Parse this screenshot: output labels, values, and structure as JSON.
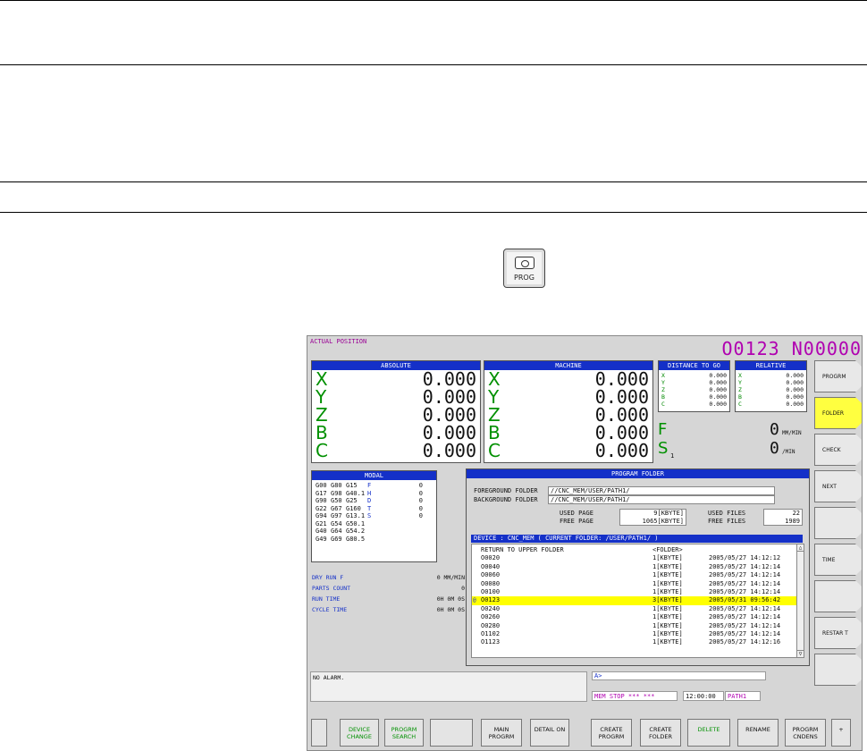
{
  "key": {
    "label": "PROG"
  },
  "screen": {
    "title": "ACTUAL POSITION",
    "program": "O0123 N00000",
    "absolute": {
      "header": "ABSOLUTE",
      "axes": [
        {
          "axis": "X",
          "value": "0.000"
        },
        {
          "axis": "Y",
          "value": "0.000"
        },
        {
          "axis": "Z",
          "value": "0.000"
        },
        {
          "axis": "B",
          "value": "0.000"
        },
        {
          "axis": "C",
          "value": "0.000"
        }
      ]
    },
    "machine": {
      "header": "MACHINE",
      "axes": [
        {
          "axis": "X",
          "value": "0.000"
        },
        {
          "axis": "Y",
          "value": "0.000"
        },
        {
          "axis": "Z",
          "value": "0.000"
        },
        {
          "axis": "B",
          "value": "0.000"
        },
        {
          "axis": "C",
          "value": "0.000"
        }
      ]
    },
    "distance": {
      "header": "DISTANCE TO GO",
      "axes": [
        {
          "axis": "X",
          "value": "0.000"
        },
        {
          "axis": "Y",
          "value": "0.000"
        },
        {
          "axis": "Z",
          "value": "0.000"
        },
        {
          "axis": "B",
          "value": "0.000"
        },
        {
          "axis": "C",
          "value": "0.000"
        }
      ]
    },
    "relative": {
      "header": "RELATIVE",
      "axes": [
        {
          "axis": "X",
          "value": "0.000"
        },
        {
          "axis": "Y",
          "value": "0.000"
        },
        {
          "axis": "Z",
          "value": "0.000"
        },
        {
          "axis": "B",
          "value": "0.000"
        },
        {
          "axis": "C",
          "value": "0.000"
        }
      ]
    },
    "feed": {
      "label": "F",
      "value": "0",
      "unit": "MM/MIN"
    },
    "spindle": {
      "label": "S",
      "sub": "1",
      "value": "0",
      "unit": "/MIN"
    },
    "modal": {
      "header": "MODAL",
      "rows": [
        [
          "G00",
          "G80",
          "G15",
          "F",
          "0"
        ],
        [
          "G17",
          "G98",
          "G40.1",
          "H",
          "0"
        ],
        [
          "G90",
          "G50",
          "G25",
          "D",
          "0"
        ],
        [
          "G22",
          "G67",
          "G160",
          "T",
          "0"
        ],
        [
          "G94",
          "G97",
          "G13.1",
          "S",
          "0"
        ],
        [
          "G21",
          "G54",
          "G50.1",
          "",
          ""
        ],
        [
          "G40",
          "G64",
          "G54.2",
          "",
          ""
        ],
        [
          "G49",
          "G69",
          "G80.5",
          "",
          ""
        ]
      ]
    },
    "info": [
      {
        "label": "DRY RUN F",
        "value": "0 MM/MIN"
      },
      {
        "label": "PARTS COUNT",
        "value": "0"
      },
      {
        "label": "RUN TIME",
        "value": "0H 0M 0S"
      },
      {
        "label": "CYCLE TIME",
        "value": "0H 0M 0S"
      }
    ],
    "folder": {
      "header": "PROGRAM FOLDER",
      "fg_label": "FOREGROUND FOLDER",
      "fg_value": "//CNC_MEM/USER/PATH1/",
      "bg_label": "BACKGROUND FOLDER",
      "bg_value": "//CNC_MEM/USER/PATH1/",
      "used_page_label": "USED PAGE",
      "used_page": "9[KBYTE]",
      "free_page_label": "FREE PAGE",
      "free_page": "1065[KBYTE]",
      "used_files_label": "USED FILES",
      "used_files": "22",
      "free_files_label": "FREE FILES",
      "free_files": "1989",
      "device_bar": "DEVICE : CNC_MEM    ( CURRENT FOLDER: /USER/PATH1/ )",
      "files": [
        {
          "mark": "",
          "name": "RETURN TO UPPER FOLDER",
          "size": "<FOLDER>",
          "date": ""
        },
        {
          "mark": "",
          "name": "O0020",
          "size": "1[KBYTE]",
          "date": "2005/05/27  14:12:12"
        },
        {
          "mark": "",
          "name": "O0040",
          "size": "1[KBYTE]",
          "date": "2005/05/27  14:12:14"
        },
        {
          "mark": "",
          "name": "O0060",
          "size": "1[KBYTE]",
          "date": "2005/05/27  14:12:14"
        },
        {
          "mark": "",
          "name": "O0080",
          "size": "1[KBYTE]",
          "date": "2005/05/27  14:12:14"
        },
        {
          "mark": "",
          "name": "O0100",
          "size": "1[KBYTE]",
          "date": "2005/05/27  14:12:14"
        },
        {
          "mark": "@",
          "name": "O0123",
          "size": "3[KBYTE]",
          "date": "2005/05/31  09:56:42",
          "selected": true
        },
        {
          "mark": "",
          "name": "O0240",
          "size": "1[KBYTE]",
          "date": "2005/05/27  14:12:14"
        },
        {
          "mark": "",
          "name": "O0260",
          "size": "1[KBYTE]",
          "date": "2005/05/27  14:12:14"
        },
        {
          "mark": "",
          "name": "O0280",
          "size": "1[KBYTE]",
          "date": "2005/05/27  14:12:14"
        },
        {
          "mark": "",
          "name": "O1102",
          "size": "1[KBYTE]",
          "date": "2005/05/27  14:12:14"
        },
        {
          "mark": "",
          "name": "O1123",
          "size": "1[KBYTE]",
          "date": "2005/05/27  14:12:16"
        }
      ]
    },
    "alarm": "NO ALARM.",
    "key_input": "A>",
    "status": {
      "mode": "MEM  STOP *** ***",
      "time": "12:00:00",
      "path": "PATH1"
    },
    "side_keys": [
      "PROGRM",
      "FOLDER",
      "CHECK",
      "NEXT",
      "",
      "TIME",
      "",
      "RESTAR T",
      ""
    ],
    "bottom_keys": [
      {
        "label": "",
        "green": false
      },
      {
        "label": "DEVICE CHANGE",
        "green": true
      },
      {
        "label": "PROGRM SEARCH",
        "green": true
      },
      {
        "label": "",
        "green": false
      },
      {
        "label": "MAIN PROGRM",
        "green": false
      },
      {
        "label": "DETAIL ON",
        "green": false
      },
      {
        "label": "CREATE PROGRM",
        "green": false
      },
      {
        "label": "CREATE FOLDER",
        "green": false
      },
      {
        "label": "DELETE",
        "green": true
      },
      {
        "label": "RENAME",
        "green": false
      },
      {
        "label": "PROGRM CNDENS",
        "green": false
      },
      {
        "label": "+",
        "green": false
      }
    ]
  }
}
